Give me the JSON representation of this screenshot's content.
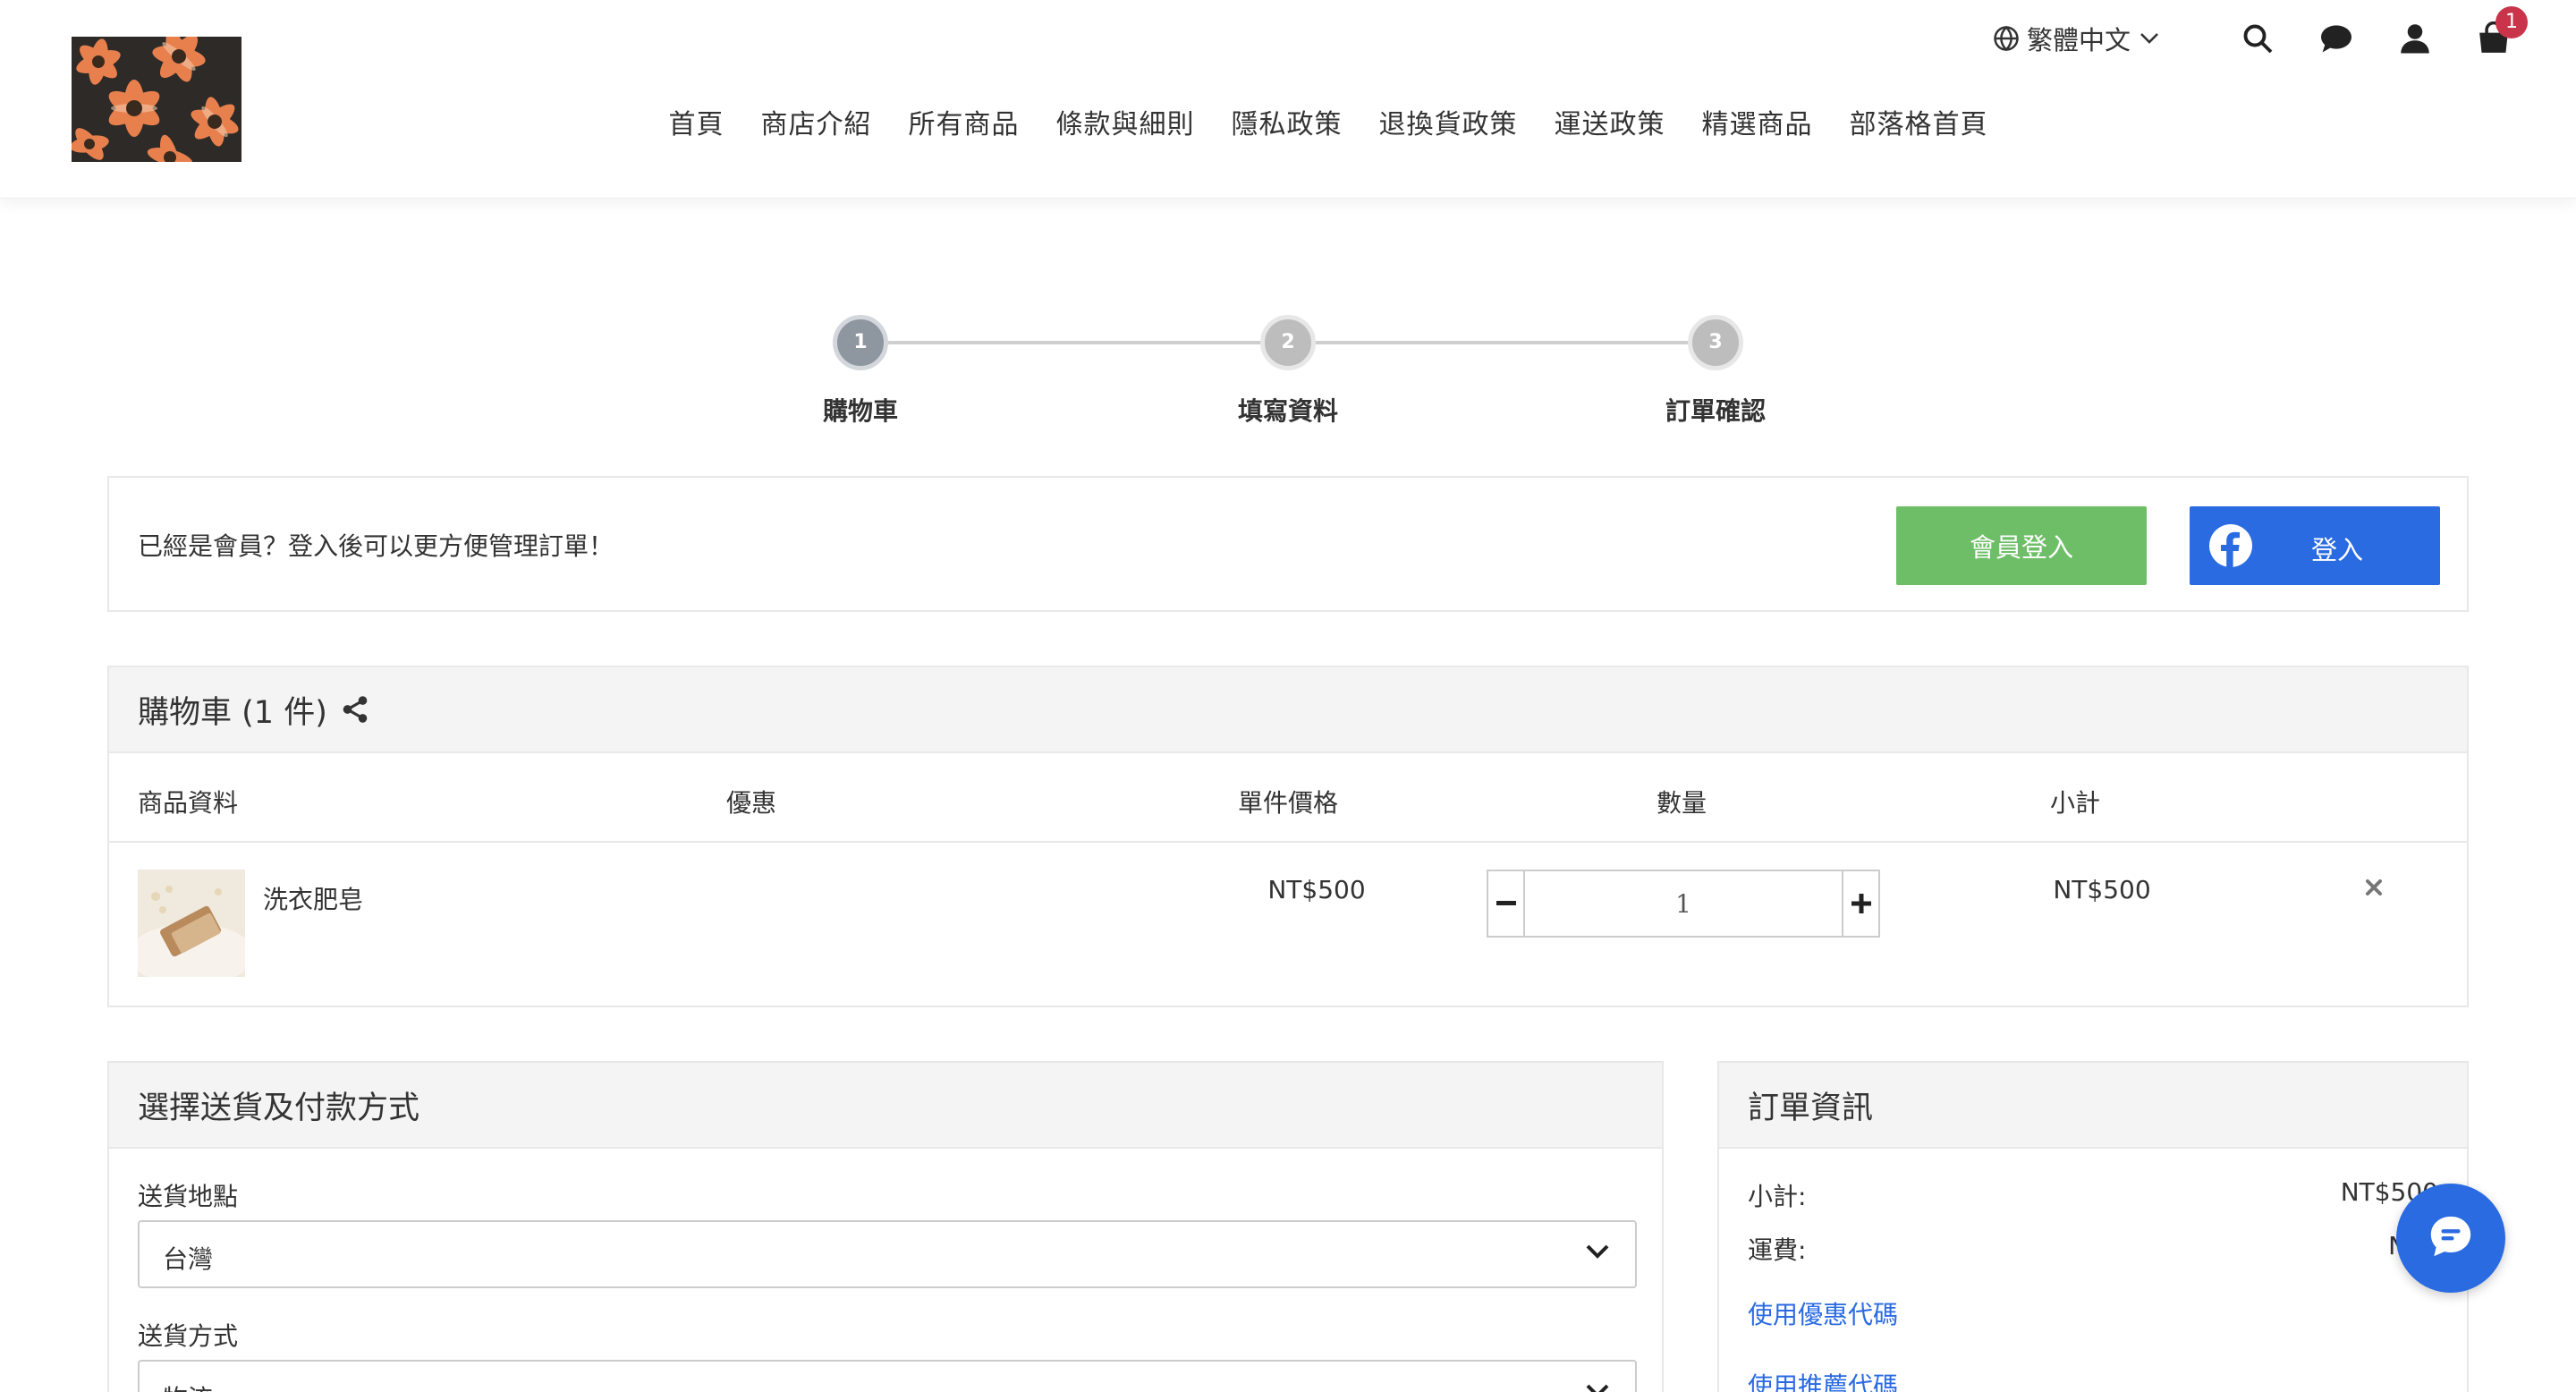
{
  "header": {
    "language": "繁體中文",
    "cart_count": "1",
    "icons": [
      "globe-icon",
      "chevron-down-icon",
      "search-icon",
      "chat-icon",
      "user-icon",
      "shopping-bag-icon"
    ],
    "nav": [
      "首頁",
      "商店介紹",
      "所有商品",
      "條款與細則",
      "隱私政策",
      "退換貨政策",
      "運送政策",
      "精選商品",
      "部落格首頁"
    ]
  },
  "stepper": {
    "steps": [
      {
        "number": "1",
        "label": "購物車"
      },
      {
        "number": "2",
        "label": "填寫資料"
      },
      {
        "number": "3",
        "label": "訂單確認"
      }
    ],
    "active_step": 1
  },
  "login_bar": {
    "message": "已經是會員？登入後可以更方便管理訂單！",
    "member_login_label": "會員登入",
    "facebook_login_label": "登入"
  },
  "cart": {
    "title": "購物車",
    "count_text": "(1 件)",
    "columns": [
      "商品資料",
      "優惠",
      "單件價格",
      "數量",
      "小計"
    ],
    "items": [
      {
        "name": "洗衣肥皂",
        "price": "NT$500",
        "quantity": "1",
        "subtotal": "NT$500"
      }
    ]
  },
  "shipping": {
    "title": "選擇送貨及付款方式",
    "location_label": "送貨地點",
    "location_value": "台灣",
    "method_label": "送貨方式",
    "method_value": "物流"
  },
  "order_info": {
    "title": "訂單資訊",
    "subtotal_label": "小計:",
    "subtotal_value": "NT$500",
    "shipping_label": "運費:",
    "shipping_value": "NT$",
    "coupon_link": "使用優惠代碼",
    "referral_link": "使用推薦代碼"
  },
  "colors": {
    "accent_blue": "#2a6be2",
    "member_green": "#6ebe67",
    "badge_red": "#c9344b",
    "active_step": "#8e96a0"
  }
}
